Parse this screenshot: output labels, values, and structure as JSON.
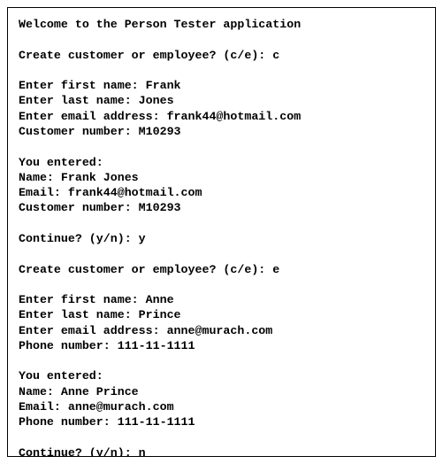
{
  "console": {
    "welcome": "Welcome to the Person Tester application",
    "blank": "",
    "session1": {
      "promptType": "Create customer or employee? (c/e): c",
      "firstName": "Enter first name: Frank",
      "lastName": "Enter last name: Jones",
      "email": "Enter email address: frank44@hotmail.com",
      "extra": "Customer number: M10293",
      "enteredHeader": "You entered:",
      "nameOut": "Name: Frank Jones",
      "emailOut": "Email: frank44@hotmail.com",
      "extraOut": "Customer number: M10293",
      "continue": "Continue? (y/n): y"
    },
    "session2": {
      "promptType": "Create customer or employee? (c/e): e",
      "firstName": "Enter first name: Anne",
      "lastName": "Enter last name: Prince",
      "email": "Enter email address: anne@murach.com",
      "extra": "Phone number: 111-11-1111",
      "enteredHeader": "You entered:",
      "nameOut": "Name: Anne Prince",
      "emailOut": "Email: anne@murach.com",
      "extraOut": "Phone number: 111-11-1111",
      "continue": "Continue? (y/n): n"
    }
  }
}
